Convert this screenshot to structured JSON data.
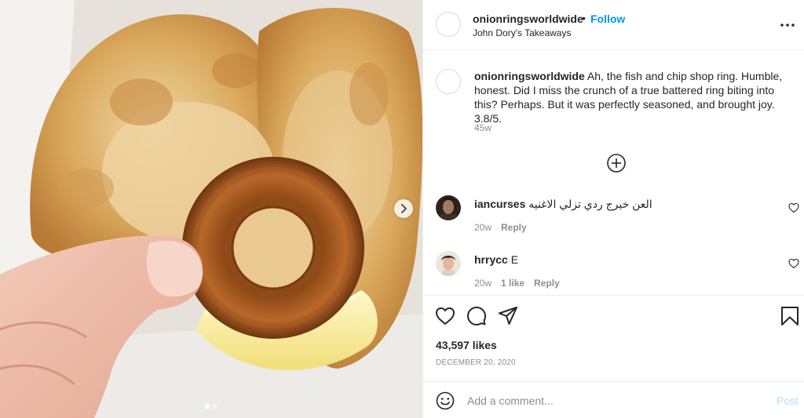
{
  "header": {
    "username": "onionringsworldwide",
    "separator": "•",
    "follow_label": "Follow",
    "location": "John Dory's Takeaways",
    "more_icon": "more-horizontal-icon"
  },
  "caption": {
    "username": "onionringsworldwide",
    "text": "Ah, the fish and chip shop ring. Humble, honest. Did I miss the crunch of a true battered ring biting into this? Perhaps. But it was perfectly seasoned, and brought joy. 3.8/5.",
    "time": "45w"
  },
  "load_more_icon": "plus-circle-icon",
  "comments": [
    {
      "username": "iancurses",
      "text": "العن خيرج ردي تزلي الاغنيه",
      "time": "20w",
      "likes": "",
      "reply_label": "Reply"
    },
    {
      "username": "hrrycc",
      "text": "E",
      "time": "20w",
      "likes": "1 like",
      "reply_label": "Reply"
    }
  ],
  "actions": {
    "likes": "43,597 likes",
    "date": "DECEMBER 20, 2020"
  },
  "add_comment": {
    "placeholder": "Add a comment...",
    "post_label": "Post"
  },
  "carousel": {
    "slide_count": 2,
    "active_index": 0
  },
  "colors": {
    "accent": "#0095f6",
    "post_disabled": "#b2dffc",
    "muted_text": "#8e8e8e",
    "primary_text": "#262626",
    "divider": "#efefef"
  }
}
